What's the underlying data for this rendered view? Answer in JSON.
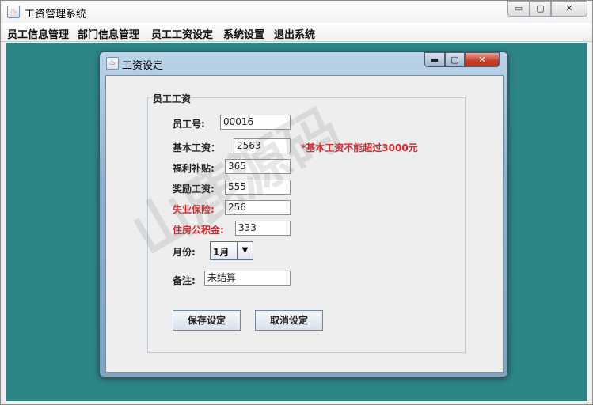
{
  "window": {
    "title": "工资管理系统",
    "controls": {
      "minimize": "▭",
      "maximize": "▢",
      "close": "✕"
    }
  },
  "menu": [
    "员工信息管理",
    "部门信息管理",
    "员工工资设定",
    "系统设置",
    "退出系统"
  ],
  "dialog": {
    "title": "工资设定",
    "controls": {
      "minimize": "▬",
      "maximize": "▢",
      "close": "✕"
    },
    "group_title": "员工工资",
    "fields": {
      "employee_id": {
        "label": "员工号:",
        "value": "00016"
      },
      "base_salary": {
        "label": "基本工资：",
        "value": "2563"
      },
      "welfare": {
        "label": "福利补贴:",
        "value": "365"
      },
      "bonus": {
        "label": "奖励工资:",
        "value": "555"
      },
      "unemployment": {
        "label": "失业保险:",
        "value": "256"
      },
      "housing_fund": {
        "label": "住房公积金:",
        "value": "333"
      },
      "month": {
        "label": "月份:",
        "value": "1月"
      },
      "remark": {
        "label": "备注:",
        "value": "未结算"
      }
    },
    "warning": "*基本工资不能超过3000元",
    "buttons": {
      "save": "保存设定",
      "cancel": "取消设定"
    }
  },
  "watermark": "山鹿源码",
  "colors": {
    "desktop": "#2e8585",
    "warning_red": "#d9262a"
  }
}
